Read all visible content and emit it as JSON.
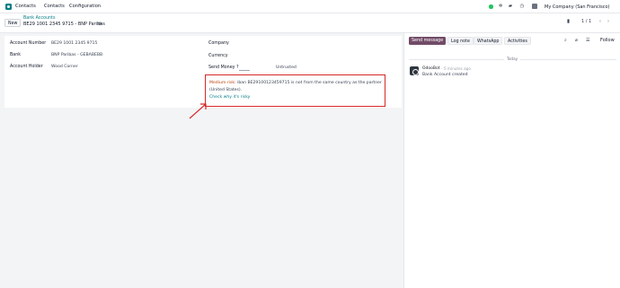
{
  "navbar": {
    "menu": [
      "Contacts",
      "Contacts",
      "Configuration"
    ],
    "company": "My Company (San Francisco)"
  },
  "control_panel": {
    "new_label": "New",
    "breadcrumb_link": "Bank Accounts",
    "record_title": "BE29 1001 2345 9715 - BNP Paribas",
    "pager": "1 / 1"
  },
  "form": {
    "account_number_label": "Account Number",
    "account_number_value": "BE29 1001 2345 9715",
    "bank_label": "Bank",
    "bank_value": "BNP Paribas - GEBABEBB",
    "holder_label": "Account Holder",
    "holder_value": "Wood Corner",
    "company_label": "Company",
    "currency_label": "Currency",
    "send_money_label": "Send Money ?",
    "send_money_value": "Untrusted"
  },
  "warning": {
    "medium": "Medium risk:",
    "text": " iban BE29100123459715 is not from the same country as the partner (United States).",
    "link": "Check why it's risky"
  },
  "chatter": {
    "send_message": "Send message",
    "log_note": "Log note",
    "whatsapp": "WhatsApp",
    "activities": "Activities",
    "follow": "Follow",
    "today": "Today",
    "author": "OdooBot",
    "time": "- 5 minutes ago",
    "body": "Bank Account created"
  }
}
